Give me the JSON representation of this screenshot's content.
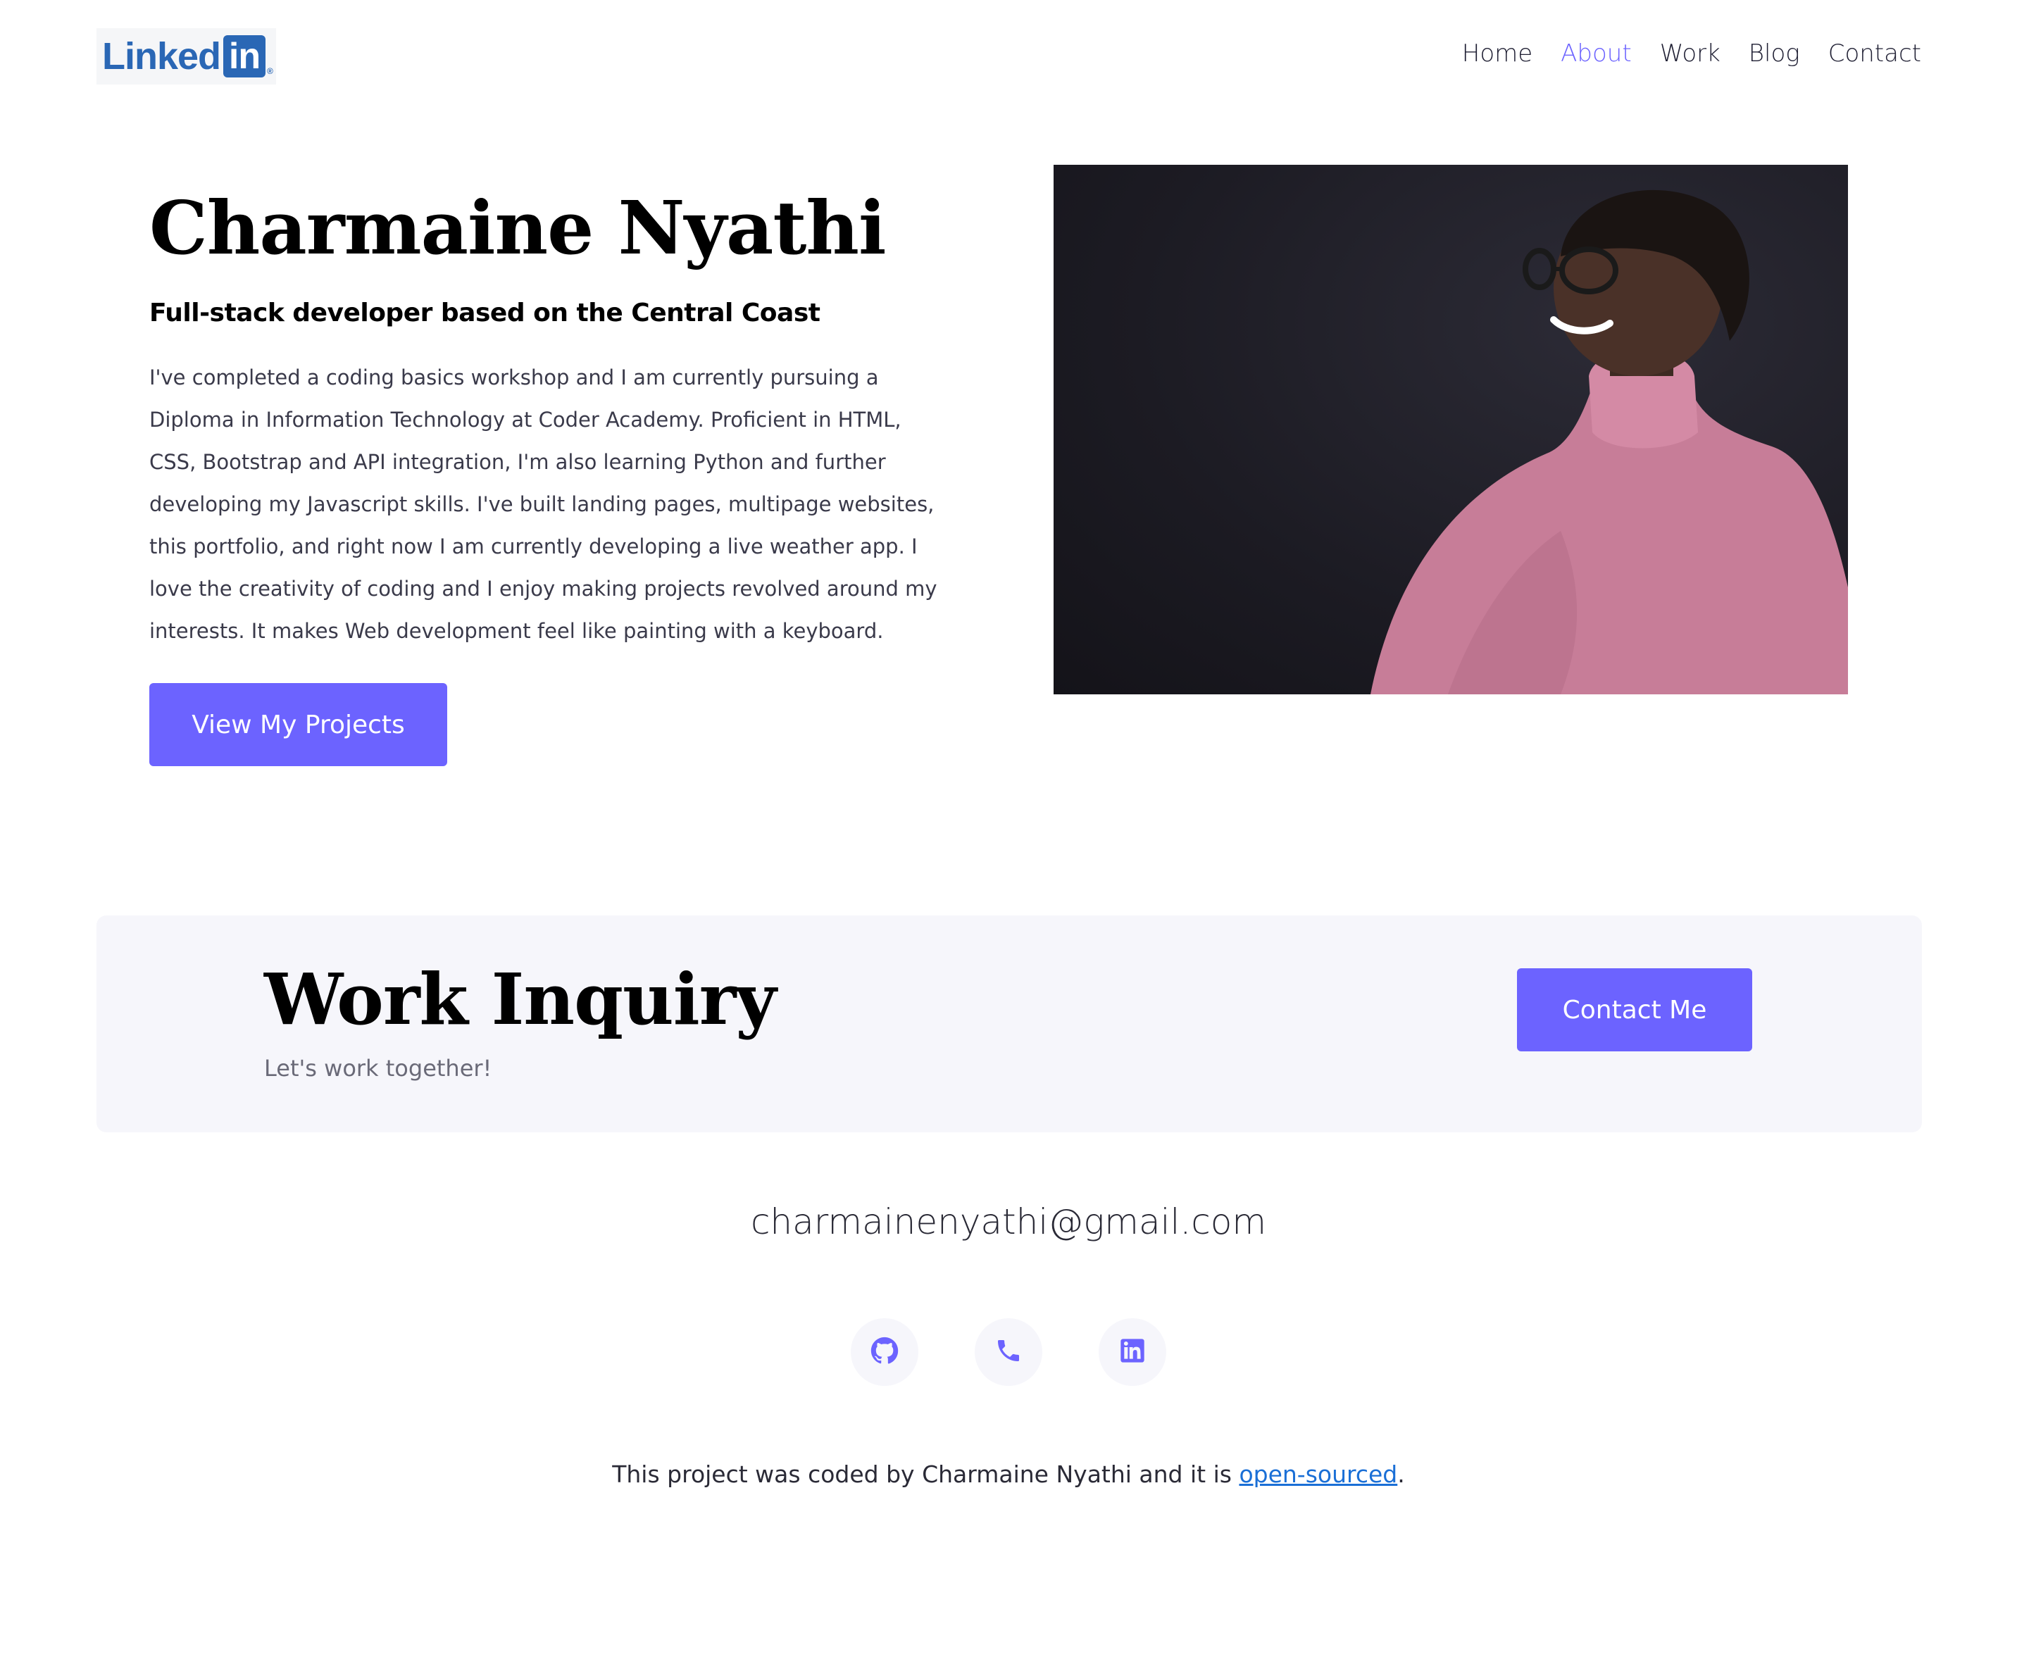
{
  "header": {
    "logo": {
      "word": "Linked",
      "box": "in",
      "mark": "®"
    },
    "nav": [
      {
        "label": "Home",
        "active": false
      },
      {
        "label": "About",
        "active": true
      },
      {
        "label": "Work",
        "active": false
      },
      {
        "label": "Blog",
        "active": false
      },
      {
        "label": "Contact",
        "active": false
      }
    ]
  },
  "hero": {
    "title": "Charmaine Nyathi",
    "subtitle": "Full-stack developer based on the Central Coast",
    "body": "I've completed a coding basics workshop and I am currently pursuing a Diploma in Information Technology at Coder Academy. Proficient in HTML, CSS, Bootstrap and API integration, I'm also learning Python and further developing my Javascript skills. I've built landing pages, multipage websites, this portfolio, and right now I am currently developing a live weather app. I love the creativity of coding and I enjoy making projects revolved around my interests. It makes Web development feel like painting with a keyboard.",
    "button_label": "View My Projects"
  },
  "inquiry": {
    "title": "Work Inquiry",
    "subtitle": "Let's work together!",
    "button_label": "Contact Me"
  },
  "footer": {
    "email": "charmainenyathi@gmail.com",
    "social": [
      {
        "icon": "github-icon"
      },
      {
        "icon": "phone-icon"
      },
      {
        "icon": "linkedin-icon"
      }
    ],
    "credit_prefix": "This project was coded by Charmaine Nyathi and it is ",
    "credit_link": "open-sourced",
    "credit_suffix": "."
  },
  "colors": {
    "accent": "#6c63ff",
    "linkedin_blue": "#2a67b5",
    "panel_bg": "#f6f6fb",
    "link": "#1a6fd6"
  }
}
